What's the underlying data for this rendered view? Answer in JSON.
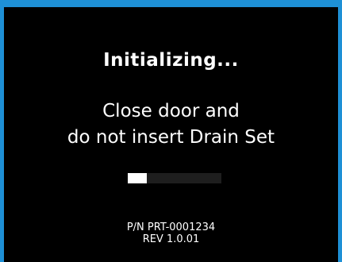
{
  "colors": {
    "border": "#1e90d6",
    "screen_background": "#000000",
    "text": "#ffffff",
    "progress_track": "#1e1e1e",
    "progress_fill": "#ffffff"
  },
  "status": {
    "title": "Initializing...",
    "message_line1": "Close door and",
    "message_line2": "do not insert Drain Set"
  },
  "progress": {
    "fraction": 0.2
  },
  "device": {
    "part_number": "P/N PRT-0001234",
    "revision": "REV 1.0.01"
  }
}
